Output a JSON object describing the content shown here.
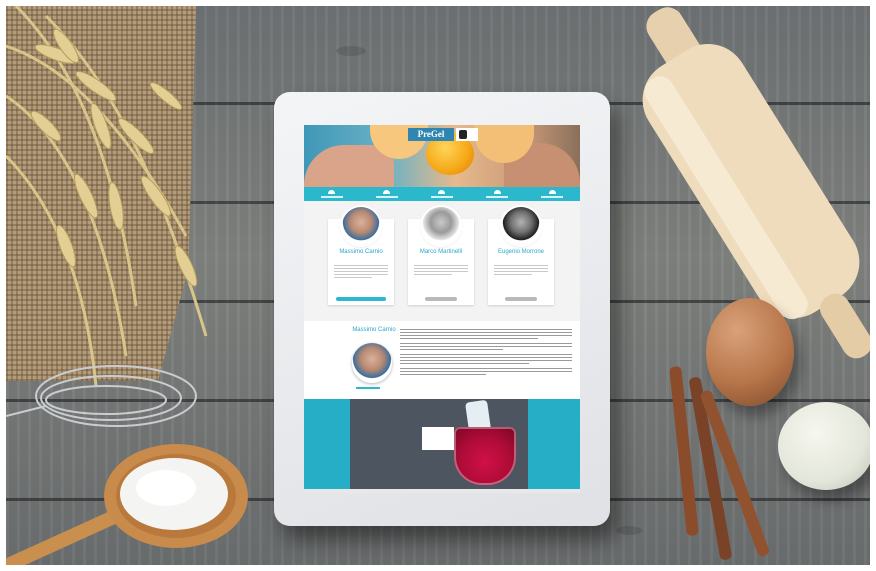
{
  "site": {
    "logo_text": "PreGel"
  },
  "navigation": {
    "items": [
      "",
      "",
      "",
      "",
      ""
    ]
  },
  "chefs": [
    {
      "name": "Massimo Carnio",
      "role": ""
    },
    {
      "name": "Marco Martinelli",
      "role": ""
    },
    {
      "name": "Eugenio Morrone",
      "role": ""
    }
  ],
  "featured": {
    "name": "Massimo Carnio"
  },
  "colors": {
    "accent": "#2bb7cc",
    "brand": "#2f86b0",
    "wood": "#7a7d7b"
  },
  "icons": {
    "nav": "home-icon",
    "badge": "school-badge-icon",
    "logo": "pregel-logo"
  }
}
